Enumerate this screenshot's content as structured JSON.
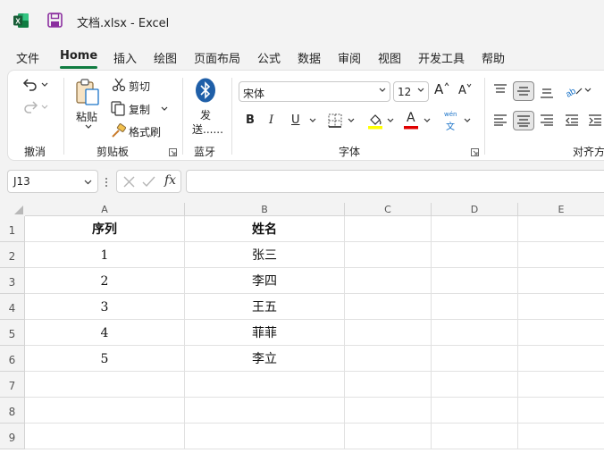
{
  "titlebar": {
    "document_title": "文档.xlsx  -  Excel",
    "app_icon": "excel-logo-icon",
    "save_icon": "save-icon"
  },
  "menu": {
    "items": [
      {
        "label": "文件"
      },
      {
        "label": "Home",
        "active": true
      },
      {
        "label": "插入"
      },
      {
        "label": "绘图"
      },
      {
        "label": "页面布局"
      },
      {
        "label": "公式"
      },
      {
        "label": "数据"
      },
      {
        "label": "审阅"
      },
      {
        "label": "视图"
      },
      {
        "label": "开发工具"
      },
      {
        "label": "帮助"
      }
    ]
  },
  "ribbon": {
    "undo_group": {
      "label": "撤消"
    },
    "clipboard_group": {
      "label": "剪贴板",
      "paste": "粘贴",
      "cut": "剪切",
      "copy": "复制",
      "format_painter": "格式刷"
    },
    "bluetooth_group": {
      "label": "蓝牙",
      "send_line1": "发",
      "send_line2": "送......"
    },
    "font_group": {
      "label": "字体",
      "font_name": "宋体",
      "font_size": "12",
      "bold": "B",
      "italic": "I",
      "underline": "U",
      "phonetic_top": "wén",
      "phonetic_bottom": "文",
      "font_color_letter": "A",
      "grow_letter": "A",
      "shrink_letter": "A"
    },
    "align_group": {
      "label": "对齐方"
    }
  },
  "formula_bar": {
    "name_box": "J13",
    "fx_label": "fx",
    "formula_value": ""
  },
  "sheet": {
    "columns": [
      "A",
      "B",
      "C",
      "D",
      "E"
    ],
    "rows": [
      {
        "num": "1",
        "a": "序列",
        "b": "姓名",
        "header": true
      },
      {
        "num": "2",
        "a": "1",
        "b": "张三"
      },
      {
        "num": "3",
        "a": "2",
        "b": "李四"
      },
      {
        "num": "4",
        "a": "3",
        "b": "王五"
      },
      {
        "num": "5",
        "a": "4",
        "b": "菲菲"
      },
      {
        "num": "6",
        "a": "5",
        "b": "李立"
      },
      {
        "num": "7",
        "a": "",
        "b": ""
      },
      {
        "num": "8",
        "a": "",
        "b": ""
      },
      {
        "num": "9",
        "a": "",
        "b": ""
      }
    ]
  },
  "colors": {
    "accent_green": "#107c41",
    "highlight_yellow": "#ffff00",
    "font_red": "#e00000"
  }
}
